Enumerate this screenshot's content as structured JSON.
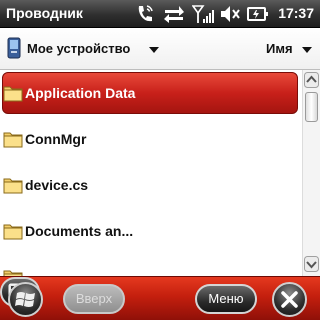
{
  "titlebar": {
    "title": "Проводник",
    "time": "17:37",
    "icons": [
      "phone-icon",
      "data-sync-icon",
      "signal-strength-icon",
      "volume-icon",
      "battery-icon"
    ]
  },
  "location": {
    "label": "Мое устройство",
    "sort_label": "Имя"
  },
  "files": [
    {
      "name": "Application Data",
      "type": "folder",
      "selected": true
    },
    {
      "name": "ConnMgr",
      "type": "folder",
      "selected": false
    },
    {
      "name": "device.cs",
      "type": "folder",
      "selected": false
    },
    {
      "name": "Documents an...",
      "type": "folder",
      "selected": false
    }
  ],
  "softkeys": {
    "up_label": "Вверх",
    "menu_label": "Меню"
  },
  "colors": {
    "selection": "#c8201a",
    "softbar": "#c41f0e",
    "titlebar": "#2f2f2f"
  }
}
